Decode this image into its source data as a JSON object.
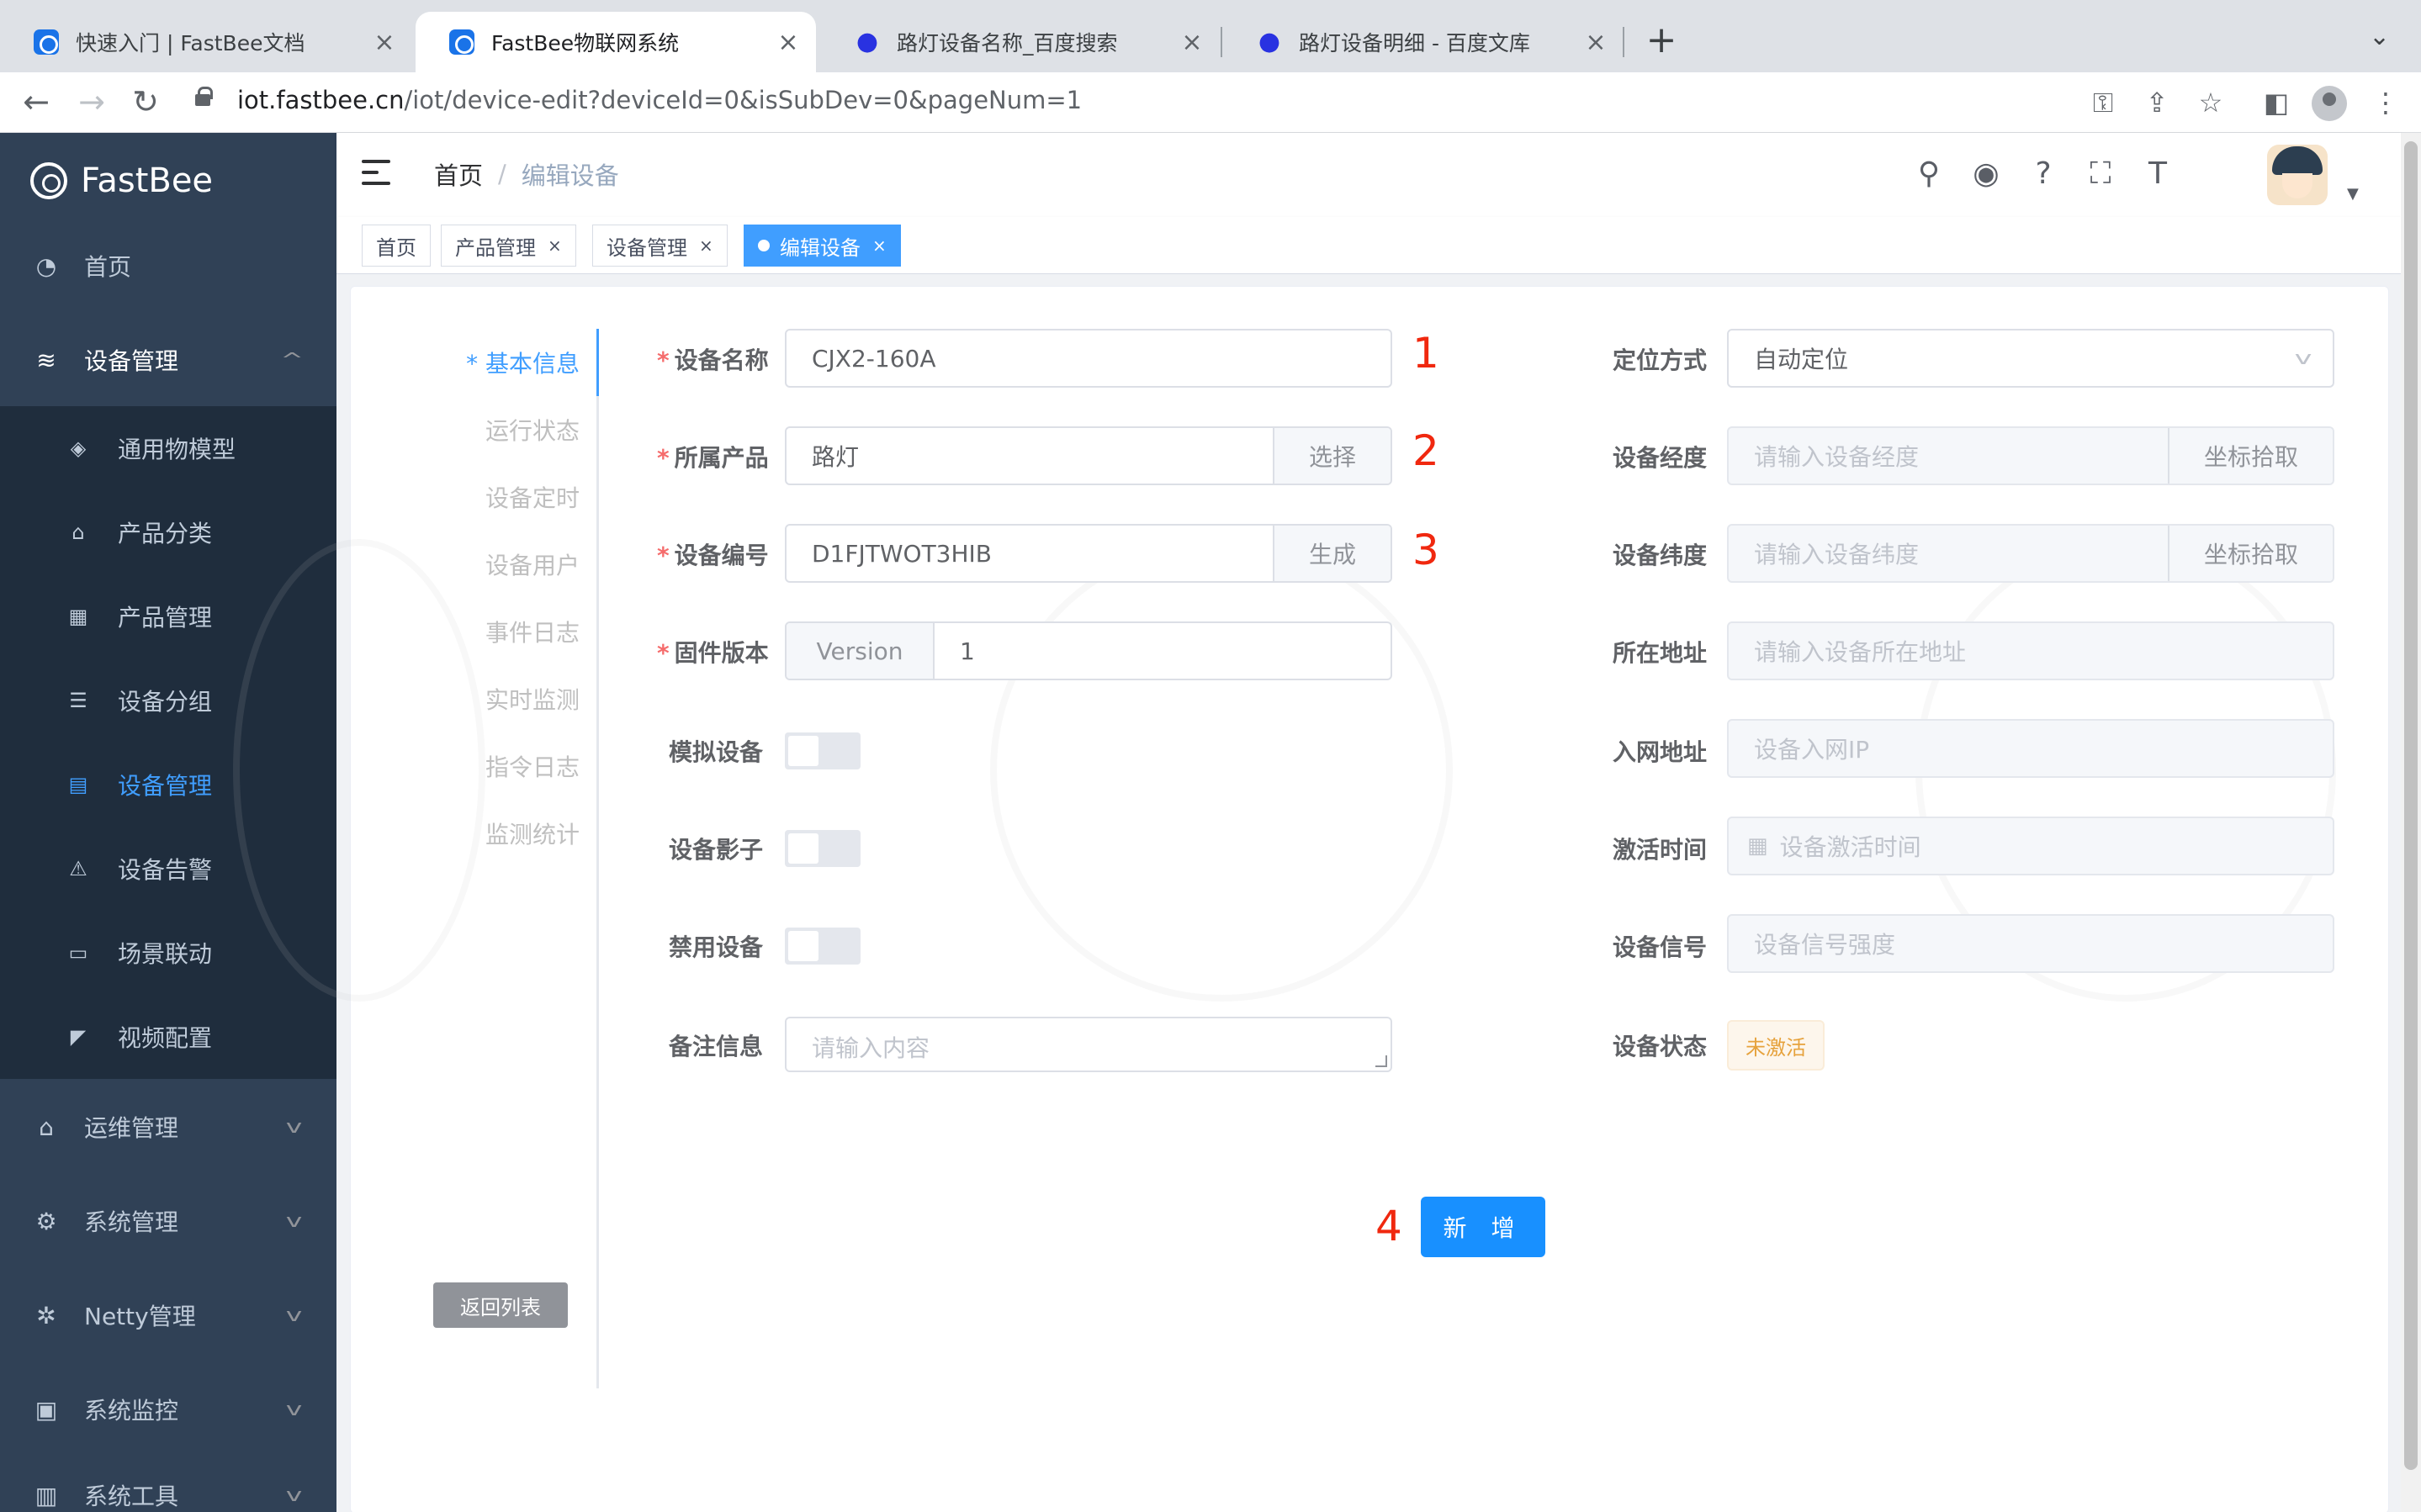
{
  "browser": {
    "tabs": [
      {
        "title": "快速入门 | FastBee文档",
        "close": "×"
      },
      {
        "title": "FastBee物联网系统",
        "close": "×"
      },
      {
        "title": "路灯设备名称_百度搜索",
        "close": "×"
      },
      {
        "title": "路灯设备明细 - 百度文库",
        "close": "×"
      }
    ],
    "new_tab": "+",
    "url_host": "iot.fastbee.cn",
    "url_path": "/iot/device-edit?deviceId=0&isSubDev=0&pageNum=1"
  },
  "sidebar": {
    "logo": "FastBee",
    "items": [
      {
        "label": "首页"
      },
      {
        "label": "设备管理"
      },
      {
        "label": "运维管理"
      },
      {
        "label": "系统管理"
      },
      {
        "label": "Netty管理"
      },
      {
        "label": "系统监控"
      },
      {
        "label": "系统工具"
      }
    ],
    "sub_items": [
      {
        "label": "通用物模型"
      },
      {
        "label": "产品分类"
      },
      {
        "label": "产品管理"
      },
      {
        "label": "设备分组"
      },
      {
        "label": "设备管理"
      },
      {
        "label": "设备告警"
      },
      {
        "label": "场景联动"
      },
      {
        "label": "视频配置"
      }
    ]
  },
  "navbar": {
    "breadcrumb_home": "首页",
    "breadcrumb_sep": "/",
    "breadcrumb_current": "编辑设备"
  },
  "tags": [
    {
      "label": "首页"
    },
    {
      "label": "产品管理",
      "close": "×"
    },
    {
      "label": "设备管理",
      "close": "×"
    },
    {
      "label": "编辑设备",
      "close": "×"
    }
  ],
  "side_tabs": [
    "* 基本信息",
    "运行状态",
    "设备定时",
    "设备用户",
    "事件日志",
    "实时监测",
    "指令日志",
    "监测统计"
  ],
  "back_button": "返回列表",
  "form": {
    "device_name": {
      "label": "设备名称",
      "value": "CJX2-160A"
    },
    "product": {
      "label": "所属产品",
      "value": "路灯",
      "button": "选择"
    },
    "serial": {
      "label": "设备编号",
      "value": "D1FJTWOT3HIB",
      "button": "生成"
    },
    "firmware": {
      "label": "固件版本",
      "prefix": "Version",
      "value": "1"
    },
    "simulate": {
      "label": "模拟设备"
    },
    "shadow": {
      "label": "设备影子"
    },
    "disable": {
      "label": "禁用设备"
    },
    "remark": {
      "label": "备注信息",
      "placeholder": "请输入内容"
    },
    "locate": {
      "label": "定位方式",
      "value": "自动定位"
    },
    "longitude": {
      "label": "设备经度",
      "placeholder": "请输入设备经度",
      "button": "坐标拾取"
    },
    "latitude": {
      "label": "设备纬度",
      "placeholder": "请输入设备纬度",
      "button": "坐标拾取"
    },
    "address": {
      "label": "所在地址",
      "placeholder": "请输入设备所在地址"
    },
    "network": {
      "label": "入网地址",
      "placeholder": "设备入网IP"
    },
    "activate": {
      "label": "激活时间",
      "placeholder": "设备激活时间"
    },
    "signal": {
      "label": "设备信号",
      "placeholder": "设备信号强度"
    },
    "status": {
      "label": "设备状态",
      "value": "未激活"
    },
    "submit": "新 增"
  },
  "annotations": [
    "1",
    "2",
    "3",
    "4"
  ],
  "colors": {
    "primary": "#1890ff",
    "sidebar_bg": "#304156",
    "submenu_bg": "#1f2d3d",
    "active_menu": "#409eff",
    "annotation_red": "#f0280f",
    "warning": "#e6a23c"
  },
  "icons": [
    "search-icon",
    "github-icon",
    "help-icon",
    "fullscreen-icon",
    "font-size-icon",
    "calendar-icon",
    "chevron-down-icon",
    "hamburger-icon"
  ]
}
